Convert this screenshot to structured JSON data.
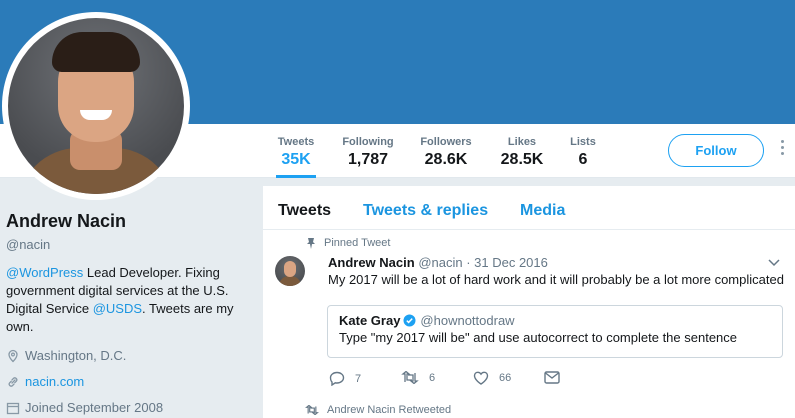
{
  "profile": {
    "name": "Andrew Nacin",
    "handle": "@nacin",
    "bio": {
      "mention1": "@WordPress",
      "text1": " Lead Developer. Fixing government digital services at the U.S. Digital Service ",
      "mention2": "@USDS",
      "text2": ". Tweets are my own."
    },
    "location": "Washington, D.C.",
    "website": "nacin.com",
    "joined": "Joined September 2008"
  },
  "stats": [
    {
      "label": "Tweets",
      "value": "35K"
    },
    {
      "label": "Following",
      "value": "1,787"
    },
    {
      "label": "Followers",
      "value": "28.6K"
    },
    {
      "label": "Likes",
      "value": "28.5K"
    },
    {
      "label": "Lists",
      "value": "6"
    }
  ],
  "follow_button": "Follow",
  "tabs": [
    "Tweets",
    "Tweets & replies",
    "Media"
  ],
  "pinned_tweet": {
    "pinned_label": "Pinned Tweet",
    "author": "Andrew Nacin",
    "handle_date": "@nacin · 31 Dec 2016",
    "text": "My 2017 will be a lot of hard work and it will probably be a lot more complicated",
    "quote": {
      "author": "Kate Gray",
      "handle": "@hownottodraw",
      "text": "Type \"my 2017 will be\" and use autocorrect to complete the sentence"
    },
    "actions": {
      "replies": "7",
      "retweets": "6",
      "likes": "66"
    }
  },
  "retweet_line": "Andrew Nacin Retweeted",
  "colors": {
    "banner": "#2b7bb9",
    "accent": "#1da1f2",
    "link": "#1b95e0",
    "muted": "#657786",
    "background": "#e6ecf0"
  },
  "icons": [
    "more-vertical-icon",
    "pin-icon",
    "chevron-down-icon",
    "verified-icon",
    "reply-icon",
    "retweet-icon",
    "like-icon",
    "message-icon",
    "location-icon",
    "link-icon",
    "calendar-icon"
  ]
}
